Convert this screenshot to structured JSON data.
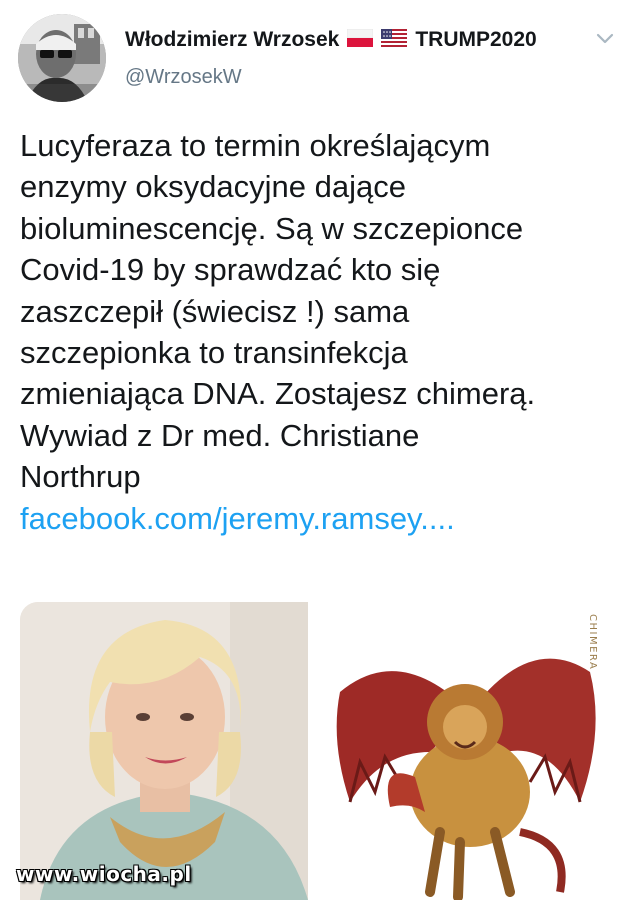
{
  "author": {
    "name": "Włodzimierz Wrzosek",
    "suffix": "TRUMP2020",
    "handle": "@WrzosekW"
  },
  "tweet": {
    "lines": [
      "Lucyferaza to termin określającym",
      "enzymy oksydacyjne dające",
      "bioluminescencję. Są w szczepionce",
      "Covid-19 by sprawdzać kto się",
      "zaszczepił (świecisz !) sama",
      "szczepionka to transinfekcja",
      "zmieniająca DNA. Zostajesz chimerą.",
      "Wywiad z Dr med. Christiane",
      "Northrup"
    ],
    "link": "facebook.com/jeremy.ramsey...."
  },
  "media": {
    "right_card_label": "CHIMERA"
  },
  "watermark": "www.wiocha.pl",
  "icons": [
    "avatar",
    "poland-flag-icon",
    "usa-flag-icon",
    "chevron-down-icon"
  ],
  "colors": {
    "link": "#1da1f2",
    "handle": "#657786",
    "text": "#14171a"
  }
}
